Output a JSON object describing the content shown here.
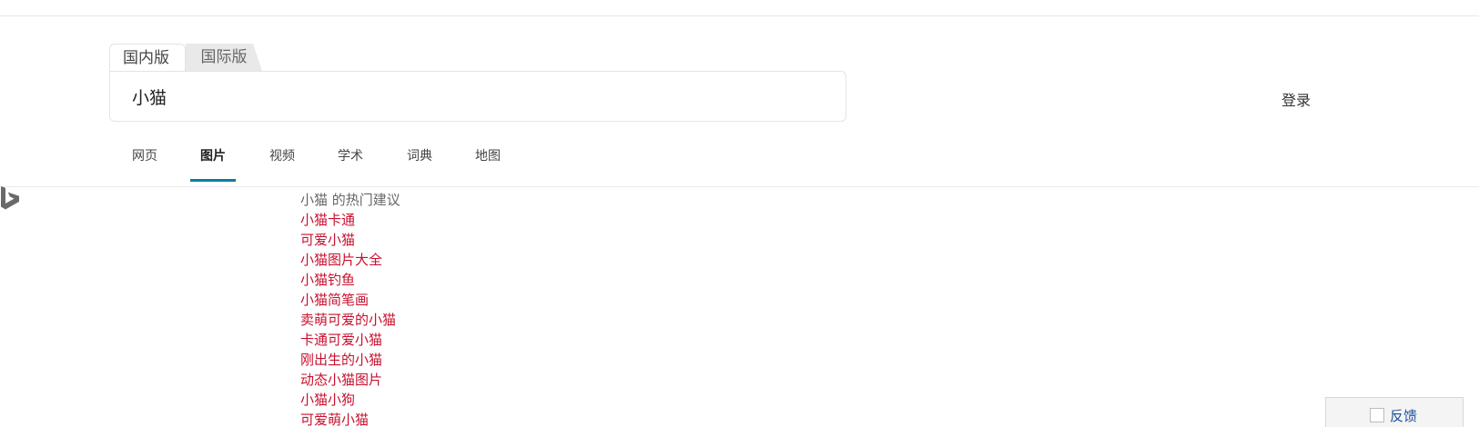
{
  "region_tabs": {
    "domestic": "国内版",
    "international": "国际版"
  },
  "search": {
    "value": "小猫"
  },
  "header": {
    "login": "登录"
  },
  "nav": {
    "items": [
      "网页",
      "图片",
      "视频",
      "学术",
      "词典",
      "地图"
    ],
    "active": "图片",
    "accent_color": "#00809d"
  },
  "logo": {
    "icon": "bing-logo-icon"
  },
  "suggestions": {
    "title": "小猫 的热门建议",
    "link_color": "#c8102e",
    "items": [
      "小猫卡通",
      "可爱小猫",
      "小猫图片大全",
      "小猫钓鱼",
      "小猫简笔画",
      "卖萌可爱的小猫",
      "卡通可爱小猫",
      "刚出生的小猫",
      "动态小猫图片",
      "小猫小狗",
      "可爱萌小猫"
    ]
  },
  "feedback": {
    "label": "反馈",
    "icon": "feedback-icon"
  }
}
